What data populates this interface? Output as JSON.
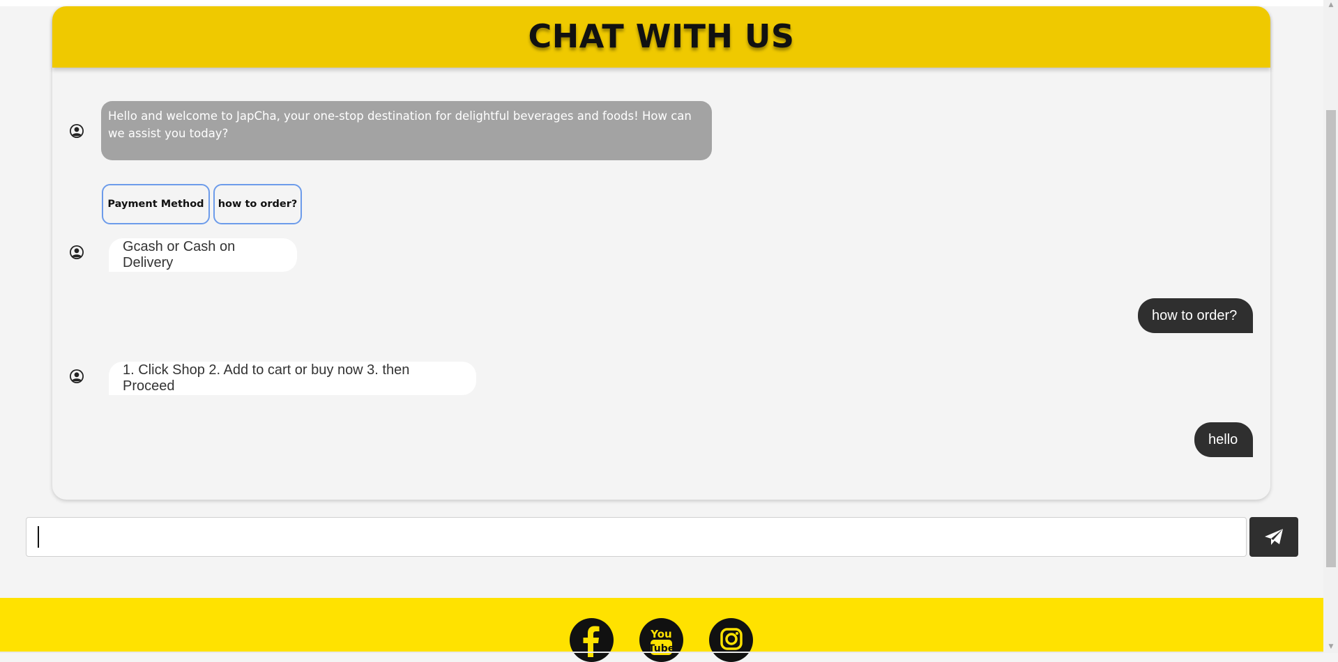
{
  "header": {
    "title": "CHAT WITH US"
  },
  "messages": {
    "welcome": "Hello and welcome to JapCha, your one-stop destination for delightful beverages and foods! How can we assist you today?",
    "quick_replies": [
      "Payment Method",
      "how to order?"
    ],
    "bot_payment_answer": "Gcash or Cash on Delivery",
    "user_how_to_order": "how to order?",
    "bot_order_answer": "1. Click Shop 2. Add to cart or buy now 3. then Proceed",
    "user_hello": "hello"
  },
  "composer": {
    "value": "",
    "send_icon": "paper-plane-icon"
  },
  "footer": {
    "social_icons": [
      "facebook-icon",
      "youtube-icon",
      "instagram-icon"
    ]
  },
  "colors": {
    "header": "#efc900",
    "footer": "#ffe200",
    "user_bubble": "#2f2f2f",
    "bot_bubble": "#a3a3a3",
    "quick_reply_border": "#6c9bea"
  }
}
